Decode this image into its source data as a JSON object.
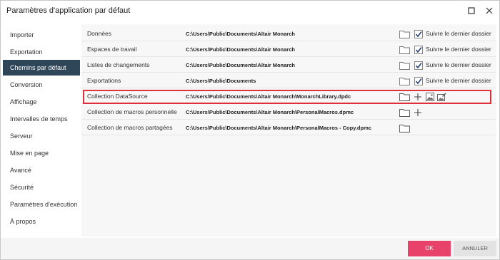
{
  "window": {
    "title": "Paramètres d'application par défaut"
  },
  "sidebar": {
    "items": [
      {
        "label": "Importer",
        "active": false
      },
      {
        "label": "Exportation",
        "active": false
      },
      {
        "label": "Chemins par défaut",
        "active": true
      },
      {
        "label": "Conversion",
        "active": false
      },
      {
        "label": "Affichage",
        "active": false
      },
      {
        "label": "Intervalles de temps",
        "active": false
      },
      {
        "label": "Serveur",
        "active": false
      },
      {
        "label": "Mise en page",
        "active": false
      },
      {
        "label": "Avancé",
        "active": false
      },
      {
        "label": "Sécurité",
        "active": false
      },
      {
        "label": "Paramètres d'exécution",
        "active": false
      },
      {
        "label": "À propos",
        "active": false
      }
    ]
  },
  "paths": {
    "rows": [
      {
        "label": "Données",
        "path": "C:\\Users\\Public\\Documents\\Altair Monarch",
        "follow_last": true,
        "follow_label": "Suivre le dernier dossier"
      },
      {
        "label": "Espaces de travail",
        "path": "C:\\Users\\Public\\Documents\\Altair Monarch",
        "follow_last": true,
        "follow_label": "Suivre le dernier dossier"
      },
      {
        "label": "Listes de changements",
        "path": "C:\\Users\\Public\\Documents\\Altair Monarch",
        "follow_last": true,
        "follow_label": "Suivre le dernier dossier"
      },
      {
        "label": "Exportations",
        "path": "C:\\Users\\Public\\Documents",
        "follow_last": true,
        "follow_label": "Suivre le dernier dossier"
      },
      {
        "label": "Collection DataSource",
        "path": "C:\\Users\\Public\\Documents\\Altair Monarch\\MonarchLibrary.dpdc",
        "highlighted": true
      },
      {
        "label": "Collection de macros personnelle",
        "path": "C:\\Users\\Public\\Documents\\Altair Monarch\\PersonalMacros.dpmc"
      },
      {
        "label": "Collection de macros partagées",
        "path": "C:\\Users\\Public\\Documents\\Altair Monarch\\PersonalMacros - Copy.dpmc"
      }
    ]
  },
  "footer": {
    "ok_label": "OK",
    "cancel_label": "ANNULER"
  },
  "colors": {
    "accent": "#e8426a",
    "sidebar_active": "#2f4558",
    "highlight_border": "#e0303a",
    "checkbox_check": "#1f3b73"
  },
  "icons": {
    "window": [
      "maximize-icon",
      "close-icon"
    ],
    "row": [
      "folder-icon",
      "plus-icon",
      "image-icon",
      "edit-image-icon",
      "checkmark-icon"
    ]
  }
}
